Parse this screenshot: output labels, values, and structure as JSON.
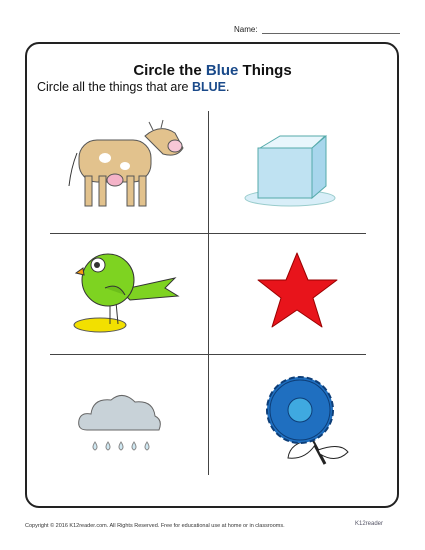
{
  "header": {
    "name_label": "Name:"
  },
  "title": {
    "part1": "Circle the ",
    "highlight": "Blue",
    "part2": " Things"
  },
  "instruction": {
    "text": "Circle all the things that are ",
    "highlight": "BLUE",
    "end": "."
  },
  "items": [
    {
      "name": "cow",
      "color": "#e2c28d"
    },
    {
      "name": "ice-cube",
      "color": "#bfe2f2"
    },
    {
      "name": "bird",
      "color": "#7ed321"
    },
    {
      "name": "star",
      "color": "#e8141b"
    },
    {
      "name": "cloud",
      "color": "#c8d2d8"
    },
    {
      "name": "flower",
      "color": "#1f6fc0"
    }
  ],
  "footer": {
    "copyright": "Copyright © 2016  K12reader.com. All Rights Reserved. Free for educational use at home or in classrooms.",
    "logo": "K12reader"
  }
}
